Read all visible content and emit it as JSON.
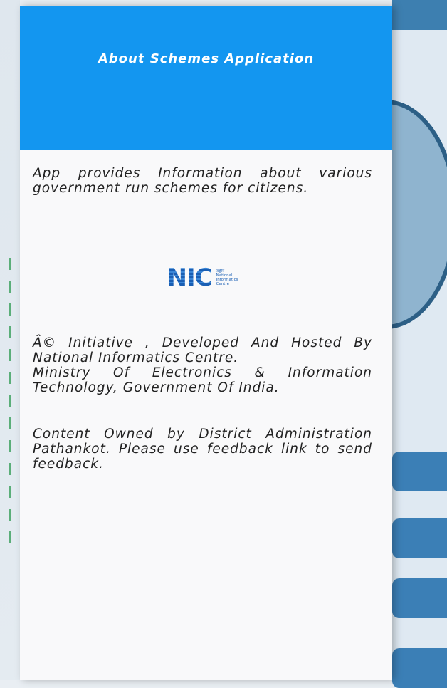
{
  "drawer": {
    "title": "About Schemes Application",
    "description": "App provides Information about various government run schemes for citizens.",
    "logo": {
      "mark": "NIC",
      "sub_line1": "राष्ट्रीय",
      "sub_line2": "National",
      "sub_line3": "Informatics",
      "sub_line4": "Centre"
    },
    "credit_line1": "Â© Initiative , Developed And Hosted By National Informatics Centre.",
    "credit_line2": "Ministry Of Electronics & Information Technology, Government Of India.",
    "content_note": "Content Owned by District Administration Pathankot. Please use feedback link to send feedback."
  },
  "colors": {
    "header_blue": "#1396f0",
    "drawer_bg": "#f9f9fa",
    "bg_button_blue": "#3b7fb6"
  }
}
